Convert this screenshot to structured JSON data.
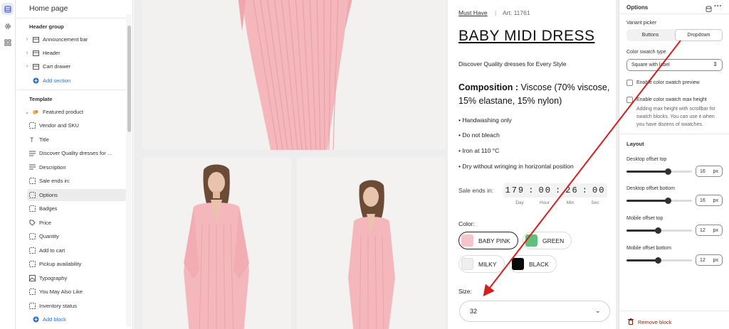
{
  "rail": {
    "items": [
      {
        "icon": "sections-icon"
      },
      {
        "icon": "gear-icon"
      },
      {
        "icon": "apps-icon"
      }
    ]
  },
  "left": {
    "title": "Home page",
    "header_group": "Header group",
    "header_items": [
      "Announcement bar",
      "Header",
      "Cart drawer"
    ],
    "add_section": "Add section",
    "template": "Template",
    "featured": "Featured product",
    "blocks": [
      "Vendor and SKU",
      "Title",
      "Discover Quality dresses for ...",
      "Description",
      "Sale ends in:",
      "Options",
      "Badges",
      "Price",
      "Quantity",
      "Add to cart",
      "Pickup availability",
      "Typography",
      "You May Also Like",
      "Inventory status"
    ],
    "add_block": "Add block"
  },
  "product": {
    "brand": "Must Have",
    "sep": "|",
    "art": "Art: 11761",
    "title": "BABY MIDI DRESS",
    "tagline": "Discover Quality dresses for Every Style",
    "comp_label": "Composition :",
    "comp_line1": " Viscose (70% viscose,",
    "comp_line2": "15% elastane, 15% nylon)",
    "care": [
      "Handwashing only",
      "Do not bleach",
      "Iron at 110 °C",
      "Dry without wringing in horizontal position"
    ],
    "sale_label": "Sale ends in:",
    "timer": {
      "d": "179",
      "h": "00",
      "m": "26",
      "s": "00",
      "sep": ":",
      "labels": [
        "Day",
        "Hour",
        "Min",
        "Sec"
      ]
    },
    "color_label": "Color:",
    "colors": [
      {
        "name": "BABY PINK",
        "hex": "#f6c4cd",
        "selected": true
      },
      {
        "name": "GREEN",
        "hex": "#5fbf7b",
        "selected": false
      },
      {
        "name": "MILKY",
        "hex": "#f0efed",
        "selected": false
      },
      {
        "name": "BLACK",
        "hex": "#0a0a0a",
        "selected": false
      }
    ],
    "size_label": "Size:",
    "size_value": "32"
  },
  "right": {
    "title": "Options",
    "variant_picker": "Variant picker",
    "seg": [
      "Buttons",
      "Dropdown"
    ],
    "seg_selected": 1,
    "swatch_type_label": "Color swatch type",
    "swatch_type_value": "Square with label",
    "cb1": "Enable color swatch preview",
    "cb2": "Enable color swatch max height",
    "cb2_help": [
      "Adding max height with scrollbar for",
      "swatch blocks. You can use it when",
      "you have dozens of swatches."
    ],
    "layout": "Layout",
    "offsets": [
      {
        "label": "Desktop offset top",
        "value": "16",
        "unit": "px",
        "level": 0.63
      },
      {
        "label": "Desktop offset bottom",
        "value": "16",
        "unit": "px",
        "level": 0.63
      },
      {
        "label": "Mobile offset top",
        "value": "12",
        "unit": "px",
        "level": 0.48
      },
      {
        "label": "Mobile offset bottom",
        "value": "12",
        "unit": "px",
        "level": 0.48
      }
    ],
    "remove": "Remove block"
  },
  "colors": {
    "accent": "#2c6ecb",
    "arrow": "#d71e1e",
    "remove": "#8e1f0b",
    "dress": "#f4b8bc"
  }
}
